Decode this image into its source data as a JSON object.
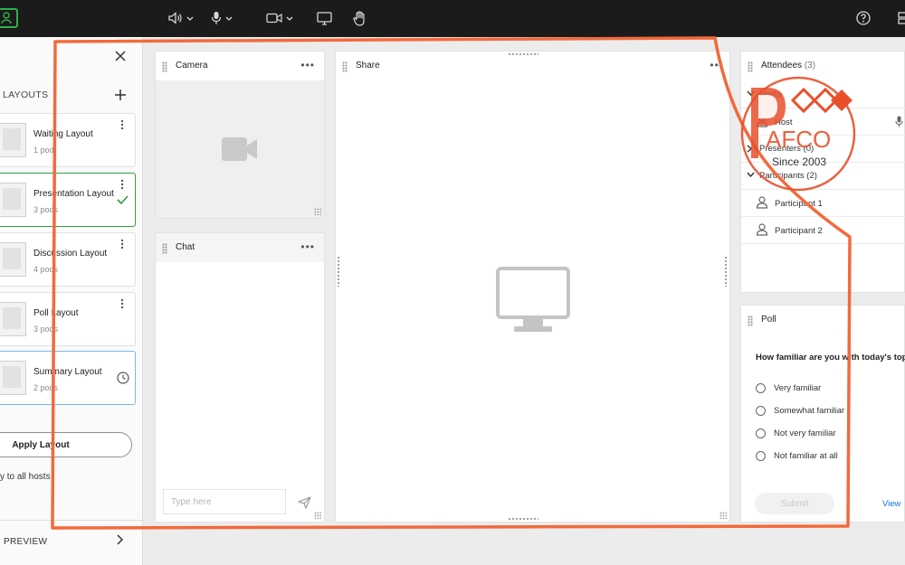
{
  "toolbar": {
    "speaker_icon": "speaker-icon",
    "mic_icon": "microphone-icon",
    "camera_icon": "video-camera-icon",
    "share_icon": "monitor-icon",
    "raise_hand_icon": "hand-icon",
    "help_icon": "help-icon",
    "layout_icon": "grid-icon",
    "user_color": "#2fb14b"
  },
  "left_panel": {
    "section_title": "LAYOUTS",
    "layouts": [
      {
        "name": "Waiting Layout",
        "pods": "1 pod",
        "status": ""
      },
      {
        "name": "Presentation Layout",
        "pods": "3 pods",
        "status": "active"
      },
      {
        "name": "Discussion Layout",
        "pods": "4 pods",
        "status": ""
      },
      {
        "name": "Poll Layout",
        "pods": "3 pods",
        "status": ""
      },
      {
        "name": "Summary Layout",
        "pods": "2 pods",
        "status": "scheduled"
      }
    ],
    "apply_label": "Apply Layout",
    "apply_note": "y to all hosts",
    "preview_label": "PREVIEW"
  },
  "pods": {
    "camera": {
      "title": "Camera"
    },
    "chat": {
      "title": "Chat",
      "placeholder": "Type here"
    },
    "share": {
      "title": "Share"
    },
    "attendees": {
      "title": "Attendees",
      "count": "(3)",
      "hosts_label": "Hosts",
      "host_name": "Host",
      "presenters_label": "Presenters (0)",
      "participants_label": "Participants (2)",
      "participants": [
        "Participant 1",
        "Participant 2"
      ]
    },
    "poll": {
      "title": "Poll",
      "question": "How familiar are you with today's top",
      "options": [
        "Very familiar",
        "Somewhat familiar",
        "Not very familiar",
        "Not familiar at all"
      ],
      "submit_label": "Submit",
      "view_label": "View"
    }
  },
  "watermark": {
    "brand": "AFCO",
    "since": "Since 2003",
    "color": "#e8502b"
  },
  "colors": {
    "annotation": "#f26a3d",
    "selected_border": "#2f9e44",
    "scheduled_border": "#7fb6e4"
  }
}
